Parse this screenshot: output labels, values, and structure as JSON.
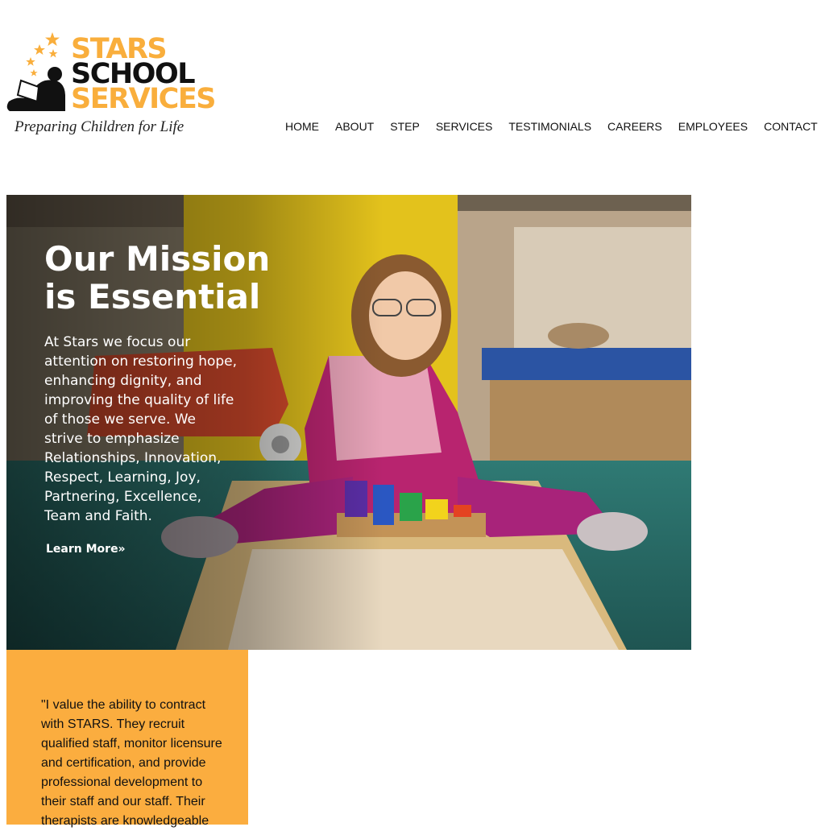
{
  "logo": {
    "line1": "STARS",
    "line2": "SCHOOL",
    "line3": "SERVICES",
    "trademark": "™",
    "tagline": "Preparing Children for Life"
  },
  "nav": {
    "items": [
      "HOME",
      "ABOUT",
      "STEP",
      "SERVICES",
      "TESTIMONIALS",
      "CAREERS",
      "EMPLOYEES",
      "CONTACT"
    ]
  },
  "hero": {
    "title": "Our Mission is Essential",
    "body": "At Stars we focus our attention on restoring hope, enhancing dignity, and improving the quality of life of those we serve. We strive to emphasize Relationships, Innovation, Respect, Learning, Joy, Partnering, Excellence, Team and Faith.",
    "link": "Learn More»"
  },
  "testimonial": {
    "text": "\"I value the ability to contract with STARS. They recruit qualified staff, monitor licensure and certification, and provide professional development to their staff and our staff. Their therapists are knowledgeable"
  },
  "colors": {
    "brand_orange": "#f9ae3c",
    "testimonial_bg": "#fbad3f",
    "text_dark": "#111111"
  }
}
